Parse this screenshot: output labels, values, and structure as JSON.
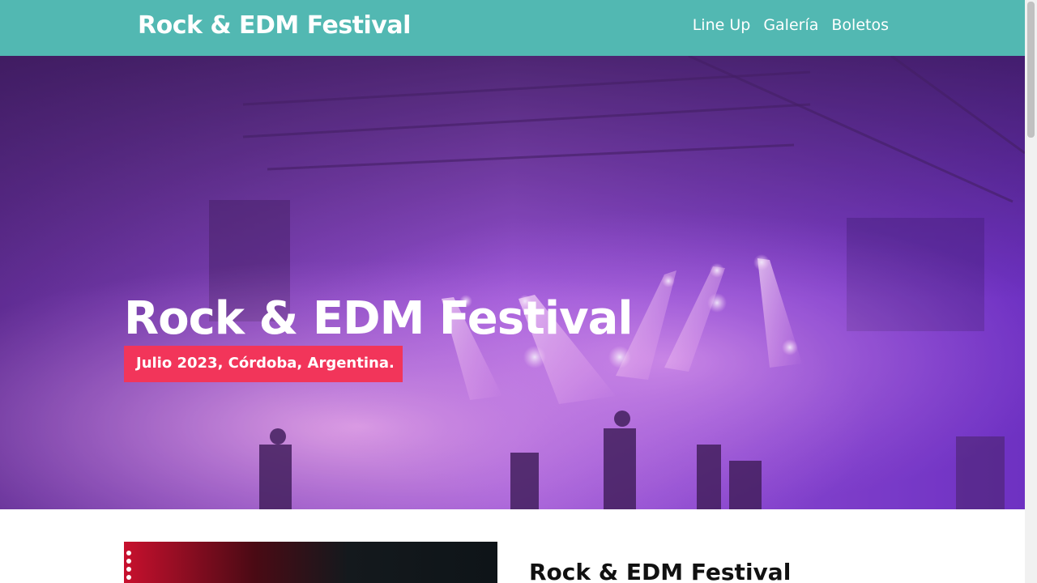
{
  "header": {
    "logo": "Rock & EDM Festival",
    "nav": [
      {
        "label": "Line Up"
      },
      {
        "label": "Galería"
      },
      {
        "label": "Boletos"
      }
    ]
  },
  "hero": {
    "title": "Rock & EDM Festival",
    "badge": "Julio 2023, Córdoba, Argentina."
  },
  "section": {
    "heading": "Rock & EDM Festival"
  },
  "colors": {
    "header_bg": "#52b8b2",
    "badge_bg": "#f2355a",
    "hero_tint": "#8a3fd6"
  }
}
